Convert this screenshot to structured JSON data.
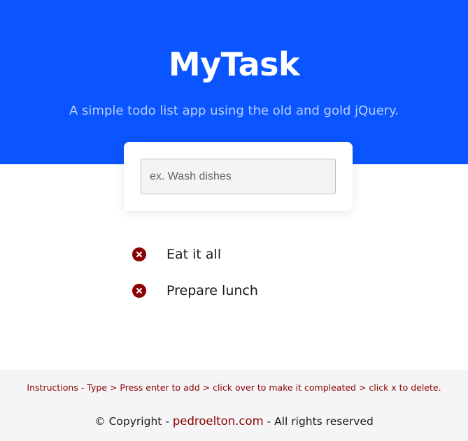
{
  "header": {
    "title": "MyTask",
    "subtitle": "A simple todo list app using the old and gold jQuery."
  },
  "input": {
    "placeholder": "ex. Wash dishes",
    "value": ""
  },
  "tasks": [
    {
      "text": "Eat it all",
      "delete_icon": "x-circle-icon"
    },
    {
      "text": "Prepare lunch",
      "delete_icon": "x-circle-icon"
    }
  ],
  "footer": {
    "instructions": "Instructions - Type > Press enter to add > click over to make it compleated > click x to delete.",
    "copyright_prefix": "© Copyright - ",
    "link_text": "pedroelton.com",
    "copyright_suffix": " - All rights reserved"
  },
  "colors": {
    "hero_background": "#0a55ff",
    "accent_dark_red": "#8b0000",
    "footer_background": "#f5f5f7"
  }
}
